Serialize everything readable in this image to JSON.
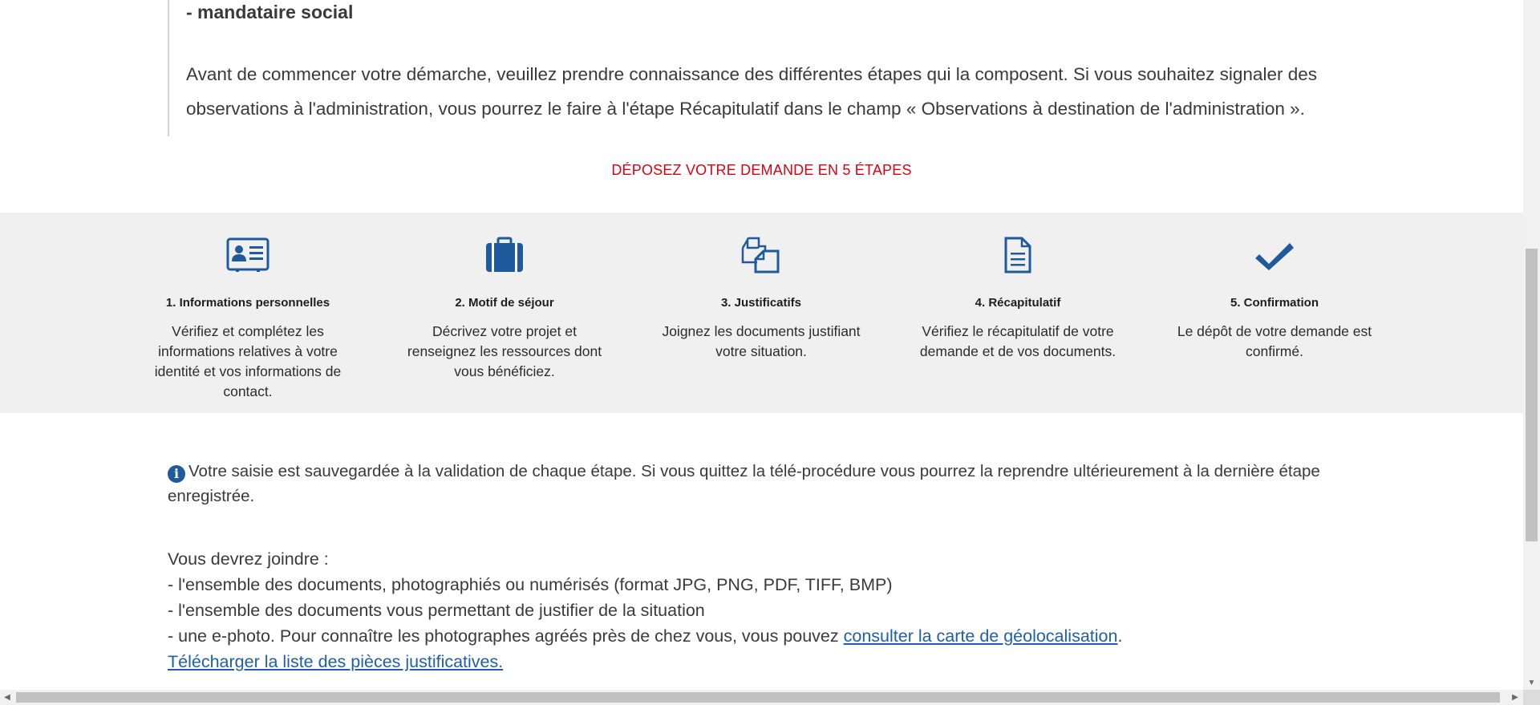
{
  "intro": {
    "role": "- mandataire social",
    "paragraph": "Avant de commencer votre démarche, veuillez prendre connaissance des différentes étapes qui la composent. Si vous souhaitez signaler des observations à l'administration, vous pourrez le faire à l'étape Récapitulatif dans le champ « Observations à destination de l'administration »."
  },
  "steps_title": "DÉPOSEZ VOTRE DEMANDE EN 5 ÉTAPES",
  "steps": [
    {
      "label": "1. Informations personnelles",
      "desc": "Vérifiez et complétez les informations relatives à votre identité et vos informations de contact.",
      "icon": "id-card-icon"
    },
    {
      "label": "2. Motif de séjour",
      "desc": "Décrivez votre projet et renseignez les ressources dont vous bénéficiez.",
      "icon": "suitcase-icon"
    },
    {
      "label": "3. Justificatifs",
      "desc": "Joignez les documents justifiant votre situation.",
      "icon": "documents-icon"
    },
    {
      "label": "4. Récapitulatif",
      "desc": "Vérifiez le récapitulatif de votre demande et de vos documents.",
      "icon": "file-text-icon"
    },
    {
      "label": "5. Confirmation",
      "desc": "Le dépôt de votre demande est confirmé.",
      "icon": "checkmark-icon"
    }
  ],
  "info": {
    "text": "Votre saisie est sauvegardée à la validation de chaque étape. Si vous quittez la télé-procédure vous pourrez la reprendre ultérieurement à la dernière étape enregistrée."
  },
  "docs": {
    "intro": "Vous devrez joindre :",
    "item1": "- l'ensemble des documents, photographiés ou numérisés (format JPG, PNG, PDF, TIFF, BMP)",
    "item2": "- l'ensemble des documents vous permettant de justifier de la situation",
    "item3_prefix": "- une e-photo. Pour connaître les photographes agréés près de chez vous, vous pouvez ",
    "item3_link": "consulter la carte de géolocalisation",
    "item3_suffix": ".",
    "download_link": "Télécharger la liste des pièces justificatives."
  },
  "colors": {
    "accent_red": "#e1000f",
    "icon_blue": "#1f5a9c",
    "link_blue": "#1f5fa8",
    "band_gray": "#f0f0f0"
  }
}
